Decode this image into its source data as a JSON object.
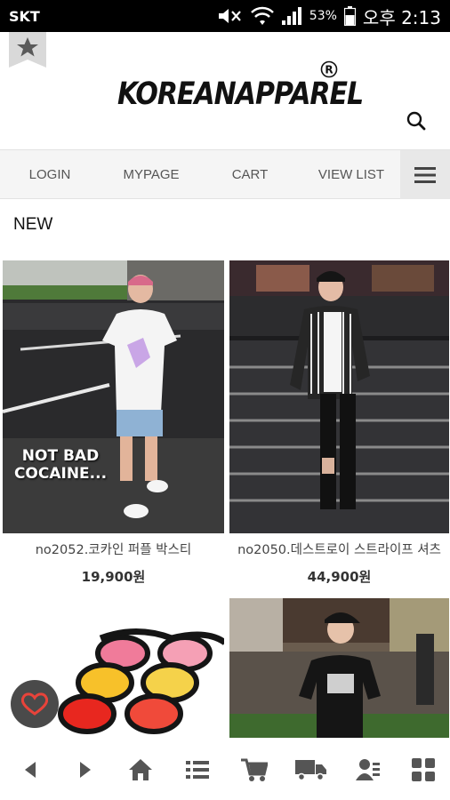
{
  "status_bar": {
    "carrier": "SKT",
    "battery_percent": "53%",
    "time": "오후 2:13",
    "icons": [
      "mute-icon",
      "wifi-icon",
      "signal-icon",
      "battery-icon"
    ]
  },
  "header": {
    "logo_text": "KOREANAPPAREL",
    "registered_mark": "R",
    "icons": [
      "bookmark-star-icon",
      "search-icon"
    ]
  },
  "nav": {
    "login": "LOGIN",
    "mypage": "MYPAGE",
    "cart": "CART",
    "view_list": "VIEW LIST",
    "menu_icon": "hamburger-menu-icon"
  },
  "section": {
    "title": "NEW"
  },
  "products": [
    {
      "name": "no2052.코카인 퍼플 박스티",
      "price": "19,900원",
      "caption": "NOT BAD COCAINE..."
    },
    {
      "name": "no2050.데스트로이 스트라이프 셔츠",
      "price": "44,900원"
    }
  ],
  "floating_button": {
    "icon": "heart-icon"
  },
  "toolbar": {
    "icons": [
      "back-arrow-icon",
      "forward-arrow-icon",
      "home-icon",
      "list-icon",
      "cart-icon",
      "delivery-truck-icon",
      "user-profile-icon",
      "grid-icon"
    ]
  },
  "colors": {
    "status_bar": "#000000",
    "nav_bg": "#f5f5f5",
    "heart": "#e8433a",
    "toolbar_icon": "#555555"
  }
}
